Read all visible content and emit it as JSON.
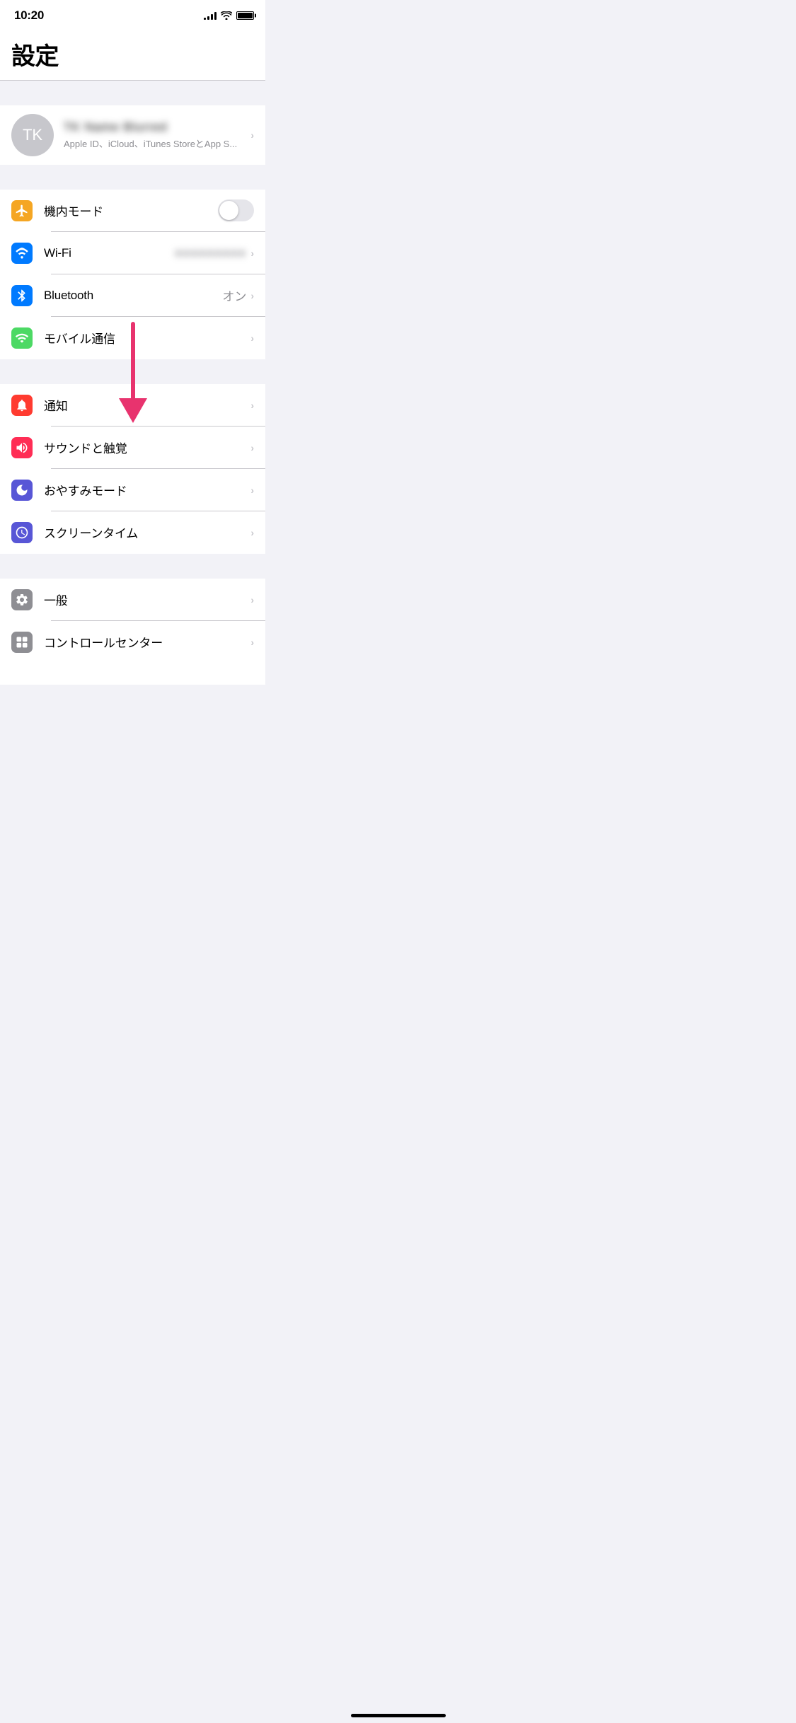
{
  "statusBar": {
    "time": "10:20"
  },
  "header": {
    "title": "設定"
  },
  "profile": {
    "initials": "TK",
    "name": "●●● ●●●●●",
    "subtitle": "Apple ID、iCloud、iTunes StoreとApp S..."
  },
  "sections": [
    {
      "id": "connectivity",
      "items": [
        {
          "id": "airplane-mode",
          "label": "機内モード",
          "iconBg": "#f5a623",
          "iconType": "airplane",
          "valueType": "toggle",
          "value": false
        },
        {
          "id": "wifi",
          "label": "Wi-Fi",
          "iconBg": "#007aff",
          "iconType": "wifi",
          "valueType": "text-blurred",
          "value": "●●●●●●●●●●"
        },
        {
          "id": "bluetooth",
          "label": "Bluetooth",
          "iconBg": "#007aff",
          "iconType": "bluetooth",
          "valueType": "text",
          "value": "オン"
        },
        {
          "id": "cellular",
          "label": "モバイル通信",
          "iconBg": "#4cd964",
          "iconType": "cellular",
          "valueType": "chevron",
          "value": ""
        }
      ]
    },
    {
      "id": "notifications",
      "items": [
        {
          "id": "notifications",
          "label": "通知",
          "iconBg": "#ff3b30",
          "iconType": "notification",
          "valueType": "chevron",
          "value": ""
        },
        {
          "id": "sounds",
          "label": "サウンドと触覚",
          "iconBg": "#ff2d55",
          "iconType": "sound",
          "valueType": "chevron",
          "value": ""
        },
        {
          "id": "donotdisturb",
          "label": "おやすみモード",
          "iconBg": "#5856d6",
          "iconType": "moon",
          "valueType": "chevron",
          "value": ""
        },
        {
          "id": "screentime",
          "label": "スクリーンタイム",
          "iconBg": "#5856d6",
          "iconType": "screentime",
          "valueType": "chevron",
          "value": ""
        }
      ]
    },
    {
      "id": "general",
      "items": [
        {
          "id": "general",
          "label": "一般",
          "iconBg": "#8e8e93",
          "iconType": "gear",
          "valueType": "chevron",
          "value": ""
        },
        {
          "id": "controlcenter",
          "label": "コントロールセンター",
          "iconBg": "#8e8e93",
          "iconType": "controlcenter",
          "valueType": "chevron",
          "value": ""
        }
      ]
    }
  ],
  "arrow": {
    "visible": true
  }
}
